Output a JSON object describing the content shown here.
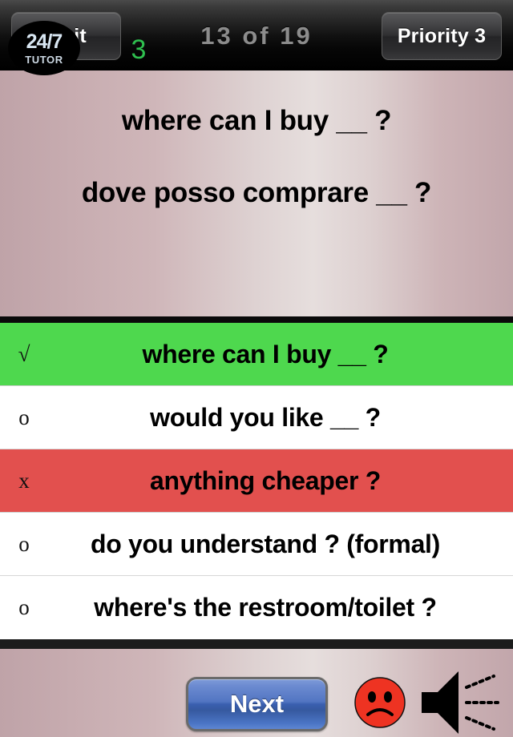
{
  "topbar": {
    "quit_label": "Quit",
    "counter_label": "13 of 19",
    "priority_label": "Priority  3"
  },
  "question": {
    "prompt": "where can I buy __ ?",
    "translation": "dove posso comprare __ ?"
  },
  "answers": {
    "items": [
      {
        "mark": "√",
        "text": "where can I buy __ ?",
        "state": "correct"
      },
      {
        "mark": "o",
        "text": "would you like __ ?",
        "state": "neutral"
      },
      {
        "mark": "x",
        "text": "anything cheaper ?",
        "state": "wrong"
      },
      {
        "mark": "o",
        "text": "do you understand ? (formal)",
        "state": "neutral"
      },
      {
        "mark": "o",
        "text": "where's the restroom/toilet ?",
        "state": "neutral"
      }
    ]
  },
  "bottombar": {
    "tutor_top": "24/7",
    "tutor_bottom": "TUTOR",
    "score": "3",
    "next_label": "Next",
    "face_icon": "sad-face-icon",
    "speaker_icon": "speaker-icon"
  },
  "colors": {
    "correct_green": "#4ed84e",
    "wrong_red": "#e2504e",
    "score_green": "#2fc04f",
    "next_blue": "#3a5fb0",
    "panel_mauve": "#c7acb0",
    "counter_gray": "#8c8c8c"
  }
}
